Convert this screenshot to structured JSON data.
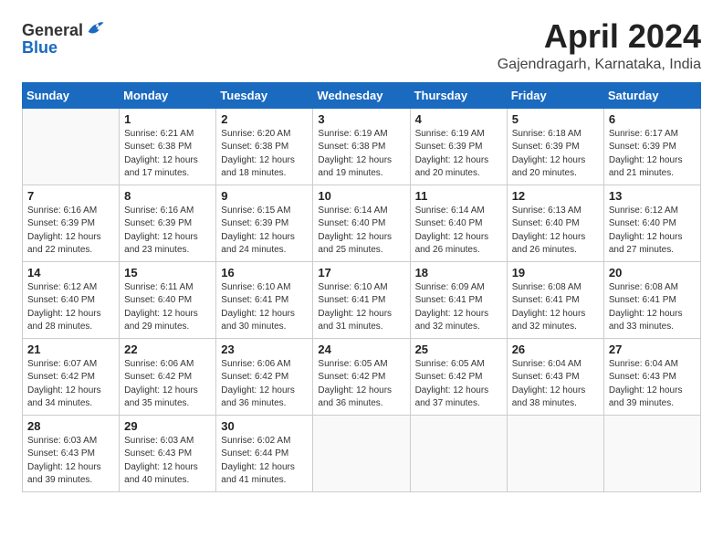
{
  "header": {
    "logo_general": "General",
    "logo_blue": "Blue",
    "month_title": "April 2024",
    "location": "Gajendragarh, Karnataka, India"
  },
  "days_of_week": [
    "Sunday",
    "Monday",
    "Tuesday",
    "Wednesday",
    "Thursday",
    "Friday",
    "Saturday"
  ],
  "weeks": [
    [
      {
        "day": "",
        "info": ""
      },
      {
        "day": "1",
        "info": "Sunrise: 6:21 AM\nSunset: 6:38 PM\nDaylight: 12 hours\nand 17 minutes."
      },
      {
        "day": "2",
        "info": "Sunrise: 6:20 AM\nSunset: 6:38 PM\nDaylight: 12 hours\nand 18 minutes."
      },
      {
        "day": "3",
        "info": "Sunrise: 6:19 AM\nSunset: 6:38 PM\nDaylight: 12 hours\nand 19 minutes."
      },
      {
        "day": "4",
        "info": "Sunrise: 6:19 AM\nSunset: 6:39 PM\nDaylight: 12 hours\nand 20 minutes."
      },
      {
        "day": "5",
        "info": "Sunrise: 6:18 AM\nSunset: 6:39 PM\nDaylight: 12 hours\nand 20 minutes."
      },
      {
        "day": "6",
        "info": "Sunrise: 6:17 AM\nSunset: 6:39 PM\nDaylight: 12 hours\nand 21 minutes."
      }
    ],
    [
      {
        "day": "7",
        "info": "Sunrise: 6:16 AM\nSunset: 6:39 PM\nDaylight: 12 hours\nand 22 minutes."
      },
      {
        "day": "8",
        "info": "Sunrise: 6:16 AM\nSunset: 6:39 PM\nDaylight: 12 hours\nand 23 minutes."
      },
      {
        "day": "9",
        "info": "Sunrise: 6:15 AM\nSunset: 6:39 PM\nDaylight: 12 hours\nand 24 minutes."
      },
      {
        "day": "10",
        "info": "Sunrise: 6:14 AM\nSunset: 6:40 PM\nDaylight: 12 hours\nand 25 minutes."
      },
      {
        "day": "11",
        "info": "Sunrise: 6:14 AM\nSunset: 6:40 PM\nDaylight: 12 hours\nand 26 minutes."
      },
      {
        "day": "12",
        "info": "Sunrise: 6:13 AM\nSunset: 6:40 PM\nDaylight: 12 hours\nand 26 minutes."
      },
      {
        "day": "13",
        "info": "Sunrise: 6:12 AM\nSunset: 6:40 PM\nDaylight: 12 hours\nand 27 minutes."
      }
    ],
    [
      {
        "day": "14",
        "info": "Sunrise: 6:12 AM\nSunset: 6:40 PM\nDaylight: 12 hours\nand 28 minutes."
      },
      {
        "day": "15",
        "info": "Sunrise: 6:11 AM\nSunset: 6:40 PM\nDaylight: 12 hours\nand 29 minutes."
      },
      {
        "day": "16",
        "info": "Sunrise: 6:10 AM\nSunset: 6:41 PM\nDaylight: 12 hours\nand 30 minutes."
      },
      {
        "day": "17",
        "info": "Sunrise: 6:10 AM\nSunset: 6:41 PM\nDaylight: 12 hours\nand 31 minutes."
      },
      {
        "day": "18",
        "info": "Sunrise: 6:09 AM\nSunset: 6:41 PM\nDaylight: 12 hours\nand 32 minutes."
      },
      {
        "day": "19",
        "info": "Sunrise: 6:08 AM\nSunset: 6:41 PM\nDaylight: 12 hours\nand 32 minutes."
      },
      {
        "day": "20",
        "info": "Sunrise: 6:08 AM\nSunset: 6:41 PM\nDaylight: 12 hours\nand 33 minutes."
      }
    ],
    [
      {
        "day": "21",
        "info": "Sunrise: 6:07 AM\nSunset: 6:42 PM\nDaylight: 12 hours\nand 34 minutes."
      },
      {
        "day": "22",
        "info": "Sunrise: 6:06 AM\nSunset: 6:42 PM\nDaylight: 12 hours\nand 35 minutes."
      },
      {
        "day": "23",
        "info": "Sunrise: 6:06 AM\nSunset: 6:42 PM\nDaylight: 12 hours\nand 36 minutes."
      },
      {
        "day": "24",
        "info": "Sunrise: 6:05 AM\nSunset: 6:42 PM\nDaylight: 12 hours\nand 36 minutes."
      },
      {
        "day": "25",
        "info": "Sunrise: 6:05 AM\nSunset: 6:42 PM\nDaylight: 12 hours\nand 37 minutes."
      },
      {
        "day": "26",
        "info": "Sunrise: 6:04 AM\nSunset: 6:43 PM\nDaylight: 12 hours\nand 38 minutes."
      },
      {
        "day": "27",
        "info": "Sunrise: 6:04 AM\nSunset: 6:43 PM\nDaylight: 12 hours\nand 39 minutes."
      }
    ],
    [
      {
        "day": "28",
        "info": "Sunrise: 6:03 AM\nSunset: 6:43 PM\nDaylight: 12 hours\nand 39 minutes."
      },
      {
        "day": "29",
        "info": "Sunrise: 6:03 AM\nSunset: 6:43 PM\nDaylight: 12 hours\nand 40 minutes."
      },
      {
        "day": "30",
        "info": "Sunrise: 6:02 AM\nSunset: 6:44 PM\nDaylight: 12 hours\nand 41 minutes."
      },
      {
        "day": "",
        "info": ""
      },
      {
        "day": "",
        "info": ""
      },
      {
        "day": "",
        "info": ""
      },
      {
        "day": "",
        "info": ""
      }
    ]
  ]
}
